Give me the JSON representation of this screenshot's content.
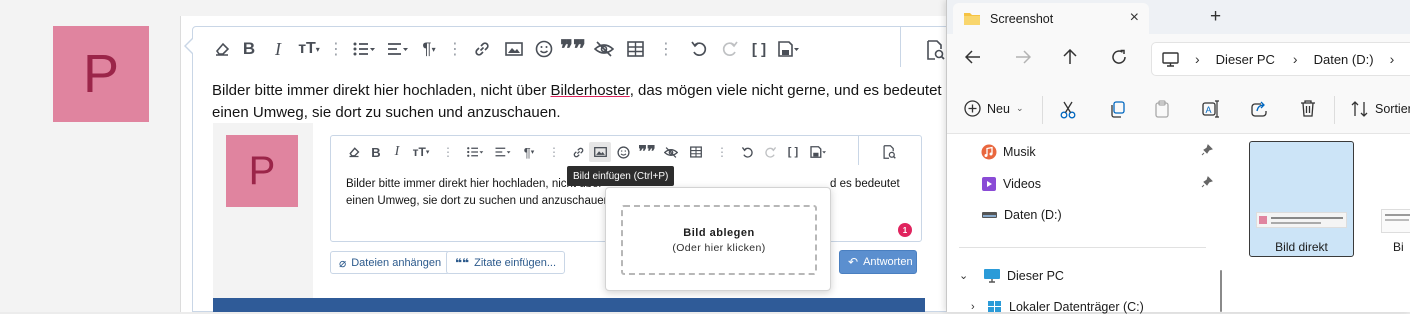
{
  "forum": {
    "avatar_letter": "P",
    "body_text_line1": "Bilder bitte immer direkt hier hochladen, nicht über ",
    "body_link": "Bilderhoster",
    "body_text_line1_rest": ", das mögen viele nicht gerne, und es bedeutet",
    "body_text_line2": "einen Umweg, sie dort zu suchen und anzuschauen.",
    "preview": {
      "avatar_letter": "P",
      "text_line1_left": "Bilder bitte immer direkt hier hochladen, nicht über",
      "text_line1_right": "d es bedeutet",
      "text_line2": "einen Umweg, sie dort zu suchen und anzuschauen.",
      "tooltip": "Bild einfügen (Ctrl+P)",
      "drop_title": "Bild ablegen",
      "drop_sub": "(Oder hier klicken)",
      "badge": "1",
      "attach_label": "Dateien anhängen",
      "quote_label": "Zitate einfügen...",
      "reply_label": "Antworten"
    }
  },
  "explorer": {
    "tab_title": "Screenshot",
    "breadcrumb": [
      "Dieser PC",
      "Daten (D:)"
    ],
    "new_label": "Neu",
    "sort_label": "Sortier",
    "sidebar": [
      {
        "label": "Musik",
        "icon": "music-icon",
        "pinned": true
      },
      {
        "label": "Videos",
        "icon": "video-icon",
        "pinned": true
      },
      {
        "label": "Daten (D:)",
        "icon": "drive-icon",
        "pinned": false
      }
    ],
    "tree_pc": "Dieser PC",
    "tree_local": "Lokaler Datenträger (C:)",
    "files": [
      {
        "label": "Bild direkt",
        "selected": true
      },
      {
        "label": "Bi",
        "selected": false
      }
    ]
  },
  "colors": {
    "avatar": "#e0849f",
    "avatar_text": "#9b2549",
    "primary_button": "#5b8fcf",
    "selection": "#cce4f7",
    "badge": "#e0245e"
  }
}
